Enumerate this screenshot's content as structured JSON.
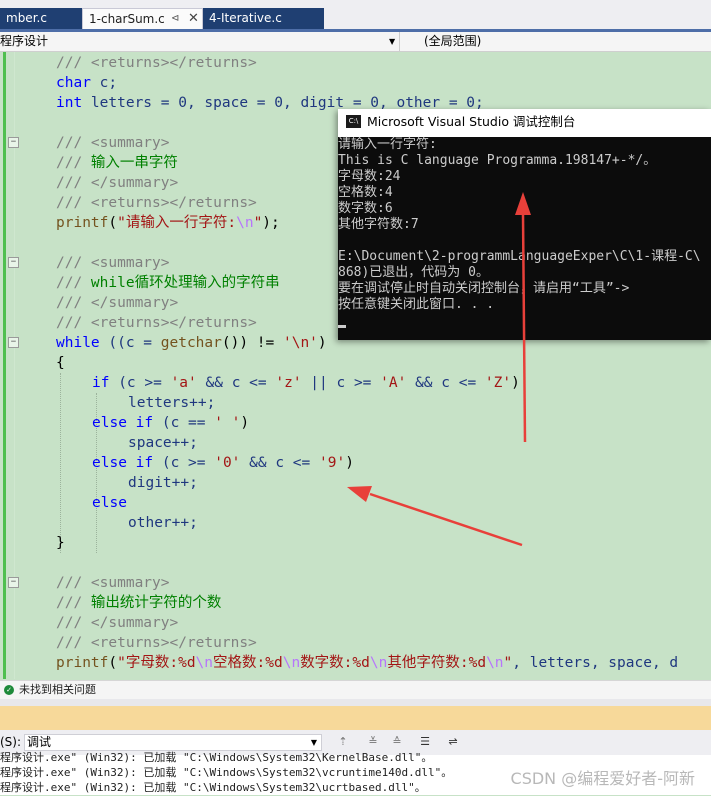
{
  "tabs": [
    {
      "label": "mber.c"
    },
    {
      "label": "1-charSum.c"
    },
    {
      "label": "4-Iterative.c"
    }
  ],
  "tab_icons": {
    "pin": "pin-icon",
    "close": "close-icon"
  },
  "navbar": {
    "scope_left": "程序设计",
    "scope_right": "(全局范围)"
  },
  "code": {
    "l1a": "/// ",
    "l1b": "<returns></returns>",
    "l2kw": "char",
    "l2rest": " c;",
    "l3kw": "int",
    "l3rest": " letters = 0, space = 0, digit = 0, other = 0;",
    "l5a": "/// ",
    "l5b": "<summary>",
    "l6a": "/// ",
    "l6b": "输入一串字符",
    "l7a": "/// ",
    "l7b": "</summary>",
    "l8a": "/// ",
    "l8b": "<returns></returns>",
    "l9fn": "printf",
    "l9a": "(",
    "l9str": "\"请输入一行字符:",
    "l9esc": "\\n",
    "l9q": "\"",
    "l9end": ");",
    "l11a": "/// ",
    "l11b": "<summary>",
    "l12a": "/// ",
    "l12b": "while循环处理输入的字符串",
    "l13a": "/// ",
    "l13b": "</summary>",
    "l14a": "/// ",
    "l14b": "<returns></returns>",
    "l15kw": "while",
    "l15a": " ((c = ",
    "l15fn": "getchar",
    "l15b": "()) != ",
    "l15str": "'\\n'",
    "l15c": ")",
    "l16": "{",
    "l17kw": "if",
    "l17a": " (c >= ",
    "l17s1": "'a'",
    "l17b": " && c <= ",
    "l17s2": "'z'",
    "l17c": " || c >= ",
    "l17s3": "'A'",
    "l17d": " && c <= ",
    "l17s4": "'Z'",
    "l17e": ")",
    "l18": "letters++;",
    "l19kw": "else if",
    "l19a": " (c == ",
    "l19s": "' '",
    "l19b": ")",
    "l20": "space++;",
    "l21kw": "else if",
    "l21a": " (c >= ",
    "l21s1": "'0'",
    "l21b": " && c <= ",
    "l21s2": "'9'",
    "l21c": ")",
    "l22": "digit++;",
    "l23kw": "else",
    "l24": "other++;",
    "l25": "}",
    "l27a": "/// ",
    "l27b": "<summary>",
    "l28a": "/// ",
    "l28b": "输出统计字符的个数",
    "l29a": "/// ",
    "l29b": "</summary>",
    "l30a": "/// ",
    "l30b": "<returns></returns>",
    "l31fn": "printf",
    "l31a": "(",
    "l31s1": "\"字母数:%d",
    "l31e1": "\\n",
    "l31s2": "空格数:%d",
    "l31e2": "\\n",
    "l31s3": "数字数:%d",
    "l31e3": "\\n",
    "l31s4": "其他字符数:%d",
    "l31e4": "\\n",
    "l31s5": "\"",
    "l31b": ", letters, space, d"
  },
  "console": {
    "title": "Microsoft Visual Studio 调试控制台",
    "icon_text": "C:\\",
    "lines": [
      "请输入一行字符:",
      "This is C language Programma.198147+-*/。",
      "字母数:24",
      "空格数:4",
      "数字数:6",
      "其他字符数:7",
      "",
      "E:\\Document\\2-programmLanguageExper\\C\\1-课程-C\\",
      "868)已退出，代码为 0。",
      "要在调试停止时自动关闭控制台，请启用“工具”->",
      "按任意键关闭此窗口. . ."
    ]
  },
  "status": {
    "message": "未找到相关问题"
  },
  "output": {
    "source_label": "(S):",
    "source_value": "调试",
    "lines": [
      "程序设计.exe\" (Win32): 已加载 \"C:\\Windows\\System32\\KernelBase.dll\"。",
      "程序设计.exe\" (Win32): 已加载 \"C:\\Windows\\System32\\vcruntime140d.dll\"。",
      "程序设计.exe\" (Win32): 已加载 \"C:\\Windows\\System32\\ucrtbased.dll\"。"
    ]
  },
  "watermark": "CSDN @编程爱好者-阿新",
  "colors": {
    "arrow": "#e8403a",
    "editor_bg": "#c7e2c7",
    "console_bg": "#0c0c0c",
    "tab_active": "#1f3f72"
  }
}
